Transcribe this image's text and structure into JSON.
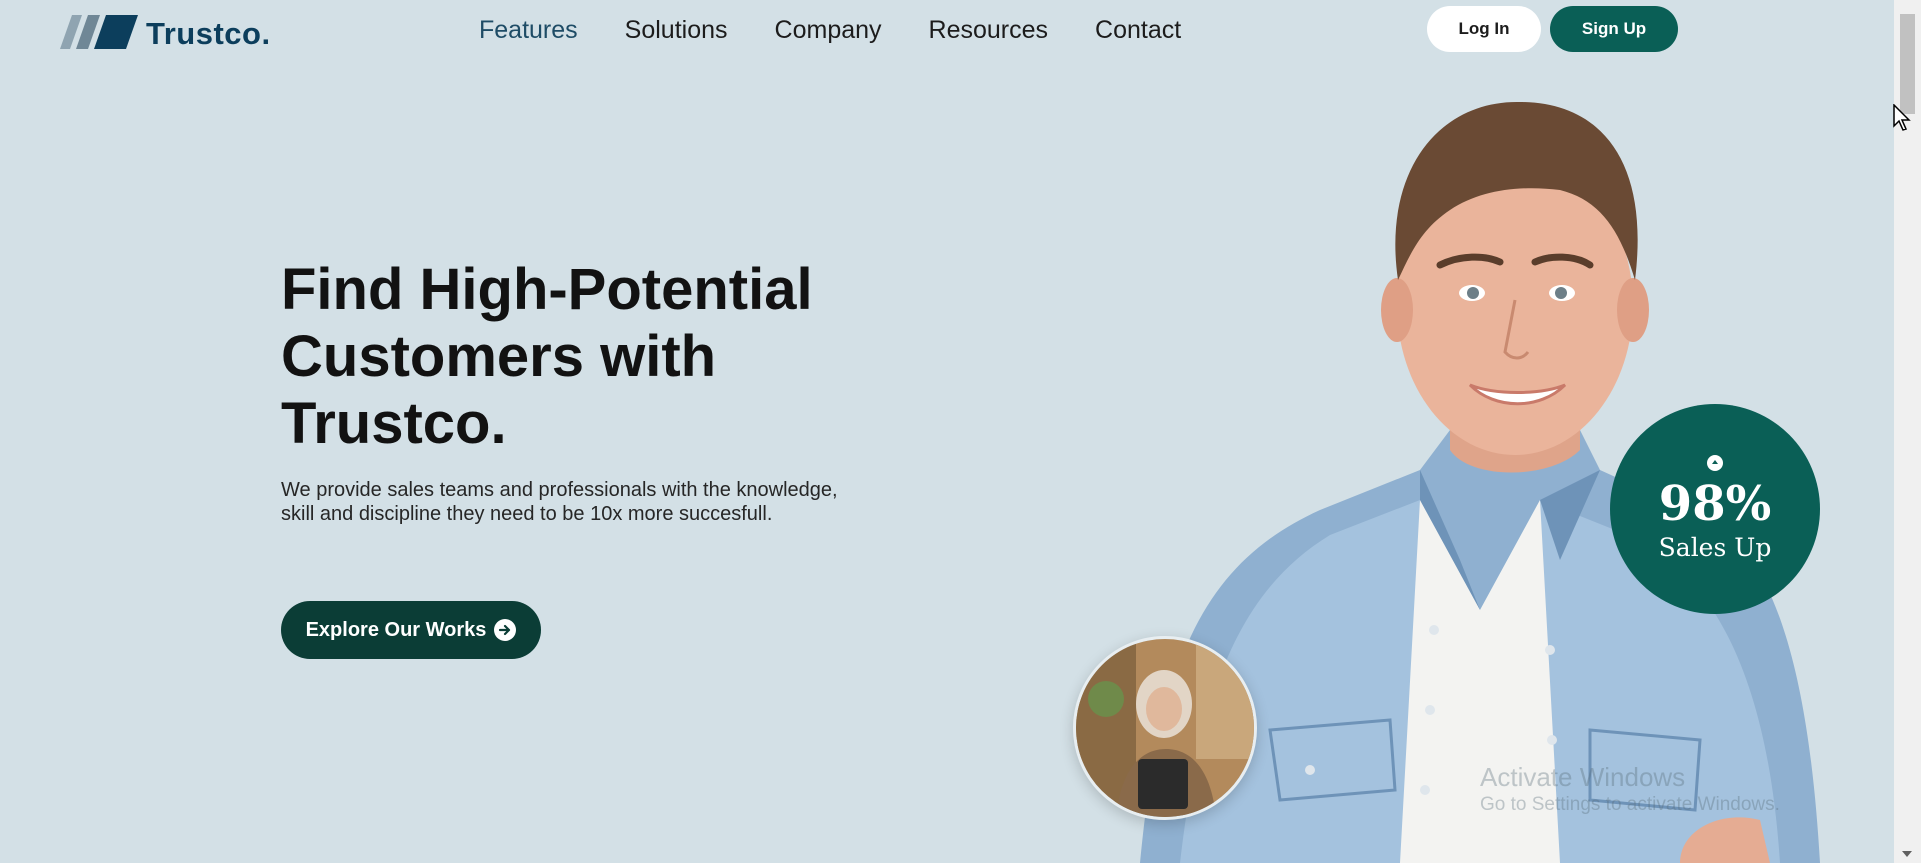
{
  "brand": {
    "name": "Trustco."
  },
  "nav": {
    "items": [
      {
        "label": "Features"
      },
      {
        "label": "Solutions"
      },
      {
        "label": "Company"
      },
      {
        "label": "Resources"
      },
      {
        "label": "Contact"
      }
    ]
  },
  "auth": {
    "login_label": "Log In",
    "signup_label": "Sign Up"
  },
  "hero": {
    "title_lines": [
      "Find High-Potential",
      "Customers with",
      "Trustco."
    ],
    "subtitle_lines": [
      "We provide sales teams and professionals with the knowledge,",
      "skill and discipline they need to be 10x more succesfull."
    ],
    "cta_label": "Explore Our Works"
  },
  "stat": {
    "value": "98%",
    "label": "Sales Up"
  },
  "watermark": {
    "line1": "Activate Windows",
    "line2": "Go to Settings to activate Windows."
  },
  "colors": {
    "background": "#d3e0e6",
    "brand_dark": "#0c3e5c",
    "accent": "#0a5f56",
    "cta": "#0b3d36"
  },
  "icons": {
    "logo": "striped-logo-icon",
    "cta": "arrow-right-circle-icon",
    "stat": "up-arrow-dot-icon"
  }
}
